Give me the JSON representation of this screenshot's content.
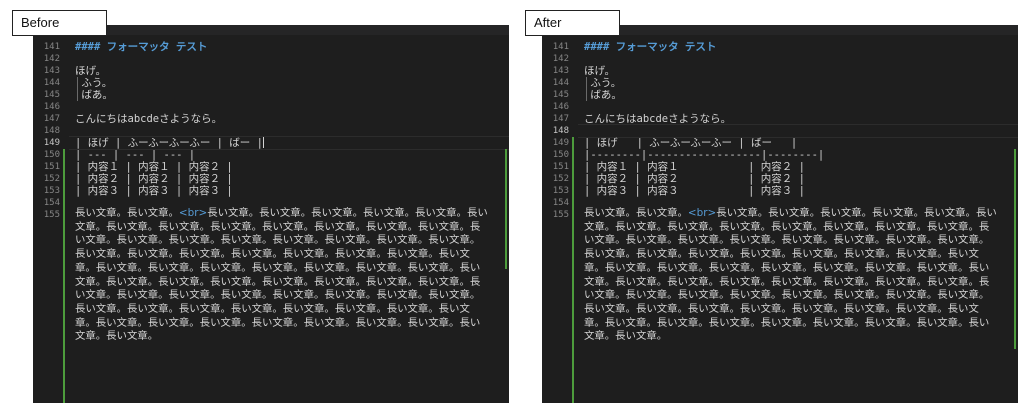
{
  "labels": {
    "before": "Before",
    "after": "After"
  },
  "before": {
    "lines": [
      {
        "n": "141",
        "t": "#### フォーマッタ テスト",
        "cls": "heading"
      },
      {
        "n": "142",
        "t": ""
      },
      {
        "n": "143",
        "t": "ほげ。"
      },
      {
        "n": "144",
        "t": " ふう。"
      },
      {
        "n": "145",
        "t": " ばあ。"
      },
      {
        "n": "146",
        "t": ""
      },
      {
        "n": "147",
        "t": "こんにちはabcdeさようなら。"
      },
      {
        "n": "148",
        "t": ""
      },
      {
        "n": "149",
        "t": "| ほげ | ふーふーふーふー | ばー |",
        "active": true
      },
      {
        "n": "150",
        "t": "| --- | --- | --- |"
      },
      {
        "n": "151",
        "t": "| 内容１ | 内容１ | 内容２ |"
      },
      {
        "n": "152",
        "t": "| 内容２ | 内容２ | 内容２ |"
      },
      {
        "n": "153",
        "t": "| 内容３ | 内容３ | 内容３ |"
      },
      {
        "n": "154",
        "t": ""
      },
      {
        "n": "155",
        "t": ""
      }
    ],
    "para_pre": "長い文章。長い文章。",
    "br_tag": "<br>",
    "para_post": "長い文章。長い文章。長い文章。長い文章。長い文章。長い文章。長い文章。長い文章。長い文章。長い文章。長い文章。長い文章。長い文章。長い文章。長い文章。長い文章。長い文章。長い文章。長い文章。長い文章。長い文章。長い文章。長い文章。長い文章。長い文章。長い文章。長い文章。長い文章。長い文章。長い文章。長い文章。長い文章。長い文章。長い文章。長い文章。長い文章。長い文章。長い文章。長い文章。長い文章。長い文章。長い文章。長い文章。長い文章。長い文章。長い文章。長い文章。長い文章。長い文章。長い文章。長い文章。長い文章。長い文章。長い文章。長い文章。長い文章。長い文章。長い文章。長い文章。長い文章。長い文章。長い文章。長い文章。長い文章。長い文章。長い文章。長い文章。長い文章。長い文章。"
  },
  "after": {
    "lines": [
      {
        "n": "141",
        "t": "#### フォーマッタ テスト",
        "cls": "heading"
      },
      {
        "n": "142",
        "t": ""
      },
      {
        "n": "143",
        "t": "ほげ。"
      },
      {
        "n": "144",
        "t": " ふう。"
      },
      {
        "n": "145",
        "t": " ばあ。"
      },
      {
        "n": "146",
        "t": ""
      },
      {
        "n": "147",
        "t": "こんにちはabcdeさようなら。"
      },
      {
        "n": "148",
        "t": "",
        "active": true
      },
      {
        "n": "149",
        "t": "| ほげ   | ふーふーふーふー | ばー   |"
      },
      {
        "n": "150",
        "t": "|--------|------------------|--------|"
      },
      {
        "n": "151",
        "t": "| 内容１ | 内容１           | 内容２ |"
      },
      {
        "n": "152",
        "t": "| 内容２ | 内容２           | 内容２ |"
      },
      {
        "n": "153",
        "t": "| 内容３ | 内容３           | 内容３ |"
      },
      {
        "n": "154",
        "t": ""
      },
      {
        "n": "155",
        "t": ""
      }
    ],
    "para_pre": "長い文章。長い文章。",
    "br_tag": "<br>",
    "para_post": "長い文章。長い文章。長い文章。長い文章。長い文章。長い文章。長い文章。長い文章。長い文章。長い文章。長い文章。長い文章。長い文章。長い文章。長い文章。長い文章。長い文章。長い文章。長い文章。長い文章。長い文章。長い文章。長い文章。長い文章。長い文章。長い文章。長い文章。長い文章。長い文章。長い文章。長い文章。長い文章。長い文章。長い文章。長い文章。長い文章。長い文章。長い文章。長い文章。長い文章。長い文章。長い文章。長い文章。長い文章。長い文章。長い文章。長い文章。長い文章。長い文章。長い文章。長い文章。長い文章。長い文章。長い文章。長い文章。長い文章。長い文章。長い文章。長い文章。長い文章。長い文章。長い文章。長い文章。長い文章。長い文章。長い文章。長い文章。長い文章。長い文章。"
  }
}
